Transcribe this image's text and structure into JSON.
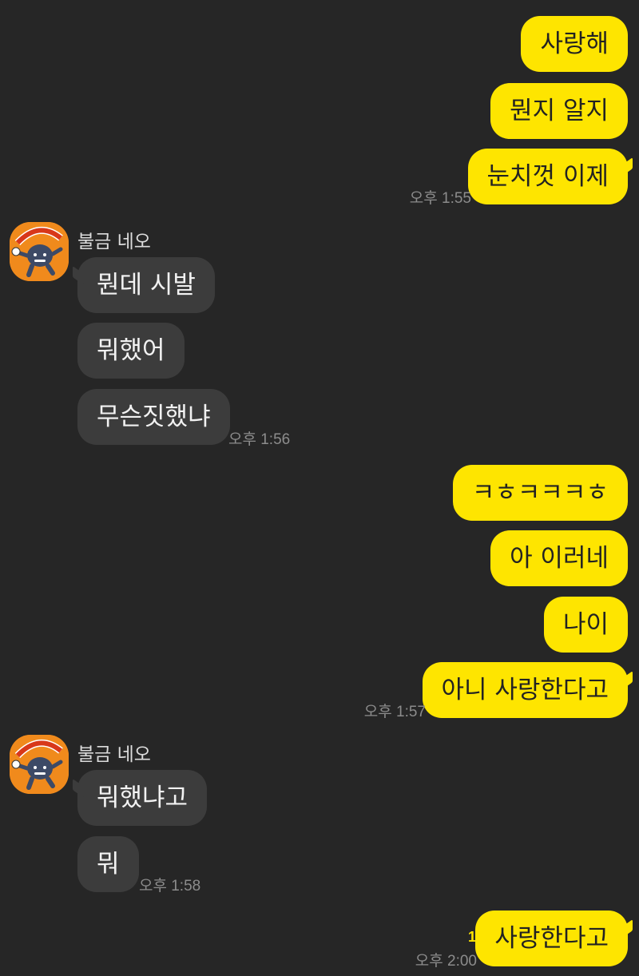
{
  "colors": {
    "background": "#262626",
    "my_bubble": "#fee500",
    "their_bubble": "#3c3c3c",
    "avatar_bg": "#f08a1c",
    "unread": "#fee500"
  },
  "group1": {
    "messages": [
      "사랑해",
      "뭔지 알지",
      "눈치껏 이제"
    ],
    "time": "오후 1:55"
  },
  "group2": {
    "sender": "불금 네오",
    "avatar_icon": "friday-neo-character-icon",
    "messages": [
      "뭔데 시발",
      "뭐했어",
      "무슨짓했냐"
    ],
    "time": "오후 1:56"
  },
  "group3": {
    "messages": [
      "ㅋㅎㅋㅋㅋㅎ",
      "아 이러네",
      "나이",
      "아니 사랑한다고"
    ],
    "time": "오후 1:57"
  },
  "group4": {
    "sender": "불금 네오",
    "avatar_icon": "friday-neo-character-icon",
    "messages": [
      "뭐했냐고",
      "뭐"
    ],
    "time": "오후 1:58"
  },
  "group5": {
    "messages": [
      "사랑한다고"
    ],
    "unread_count": "1",
    "time": "오후 2:00"
  }
}
